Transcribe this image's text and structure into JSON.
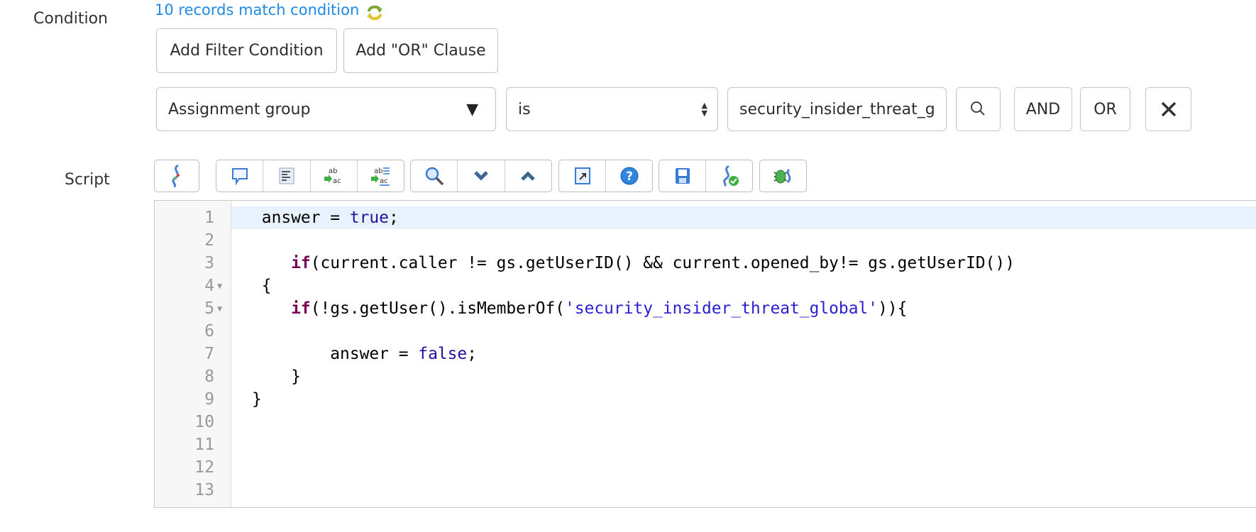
{
  "condition": {
    "label": "Condition",
    "match_link": "10 records match condition",
    "add_filter_label": "Add Filter Condition",
    "add_or_label": "Add \"OR\" Clause",
    "field_value": "Assignment group",
    "operator_value": "is",
    "value_input": "security_insider_threat_g",
    "and_label": "AND",
    "or_label": "OR"
  },
  "script": {
    "label": "Script",
    "toolbar": [
      [
        "script-include-icon"
      ],
      [
        "comment-icon",
        "format-code-icon",
        "replace-icon",
        "replace-all-icon"
      ],
      [
        "search-icon",
        "next-icon",
        "previous-icon"
      ],
      [
        "fullscreen-icon",
        "help-icon"
      ],
      [
        "save-icon",
        "syntax-check-icon"
      ],
      [
        "debug-icon"
      ]
    ],
    "lines": [
      {
        "n": "1",
        "fold": "",
        "tokens": [
          {
            "t": " answer = "
          },
          {
            "t": "true",
            "c": "atom"
          },
          {
            "t": ";"
          }
        ]
      },
      {
        "n": "2",
        "fold": "",
        "tokens": []
      },
      {
        "n": "3",
        "fold": "",
        "tokens": [
          {
            "t": "    "
          },
          {
            "t": "if",
            "c": "kw"
          },
          {
            "t": "(current.caller != gs.getUserID() && current.opened_by!= gs.getUserID())"
          }
        ]
      },
      {
        "n": "4",
        "fold": "▼",
        "tokens": [
          {
            "t": " {"
          }
        ]
      },
      {
        "n": "5",
        "fold": "▼",
        "tokens": [
          {
            "t": "    "
          },
          {
            "t": "if",
            "c": "kw"
          },
          {
            "t": "(!gs.getUser().isMemberOf("
          },
          {
            "t": "'security_insider_threat_global'",
            "c": "str"
          },
          {
            "t": ")){"
          }
        ]
      },
      {
        "n": "6",
        "fold": "",
        "tokens": []
      },
      {
        "n": "7",
        "fold": "",
        "tokens": [
          {
            "t": "        answer = "
          },
          {
            "t": "false",
            "c": "atom"
          },
          {
            "t": ";"
          }
        ]
      },
      {
        "n": "8",
        "fold": "",
        "tokens": [
          {
            "t": "    }"
          }
        ]
      },
      {
        "n": "9",
        "fold": "",
        "tokens": [
          {
            "t": "}"
          }
        ]
      },
      {
        "n": "10",
        "fold": "",
        "tokens": []
      },
      {
        "n": "11",
        "fold": "",
        "tokens": []
      },
      {
        "n": "12",
        "fold": "",
        "tokens": []
      },
      {
        "n": "13",
        "fold": "",
        "tokens": []
      }
    ]
  }
}
